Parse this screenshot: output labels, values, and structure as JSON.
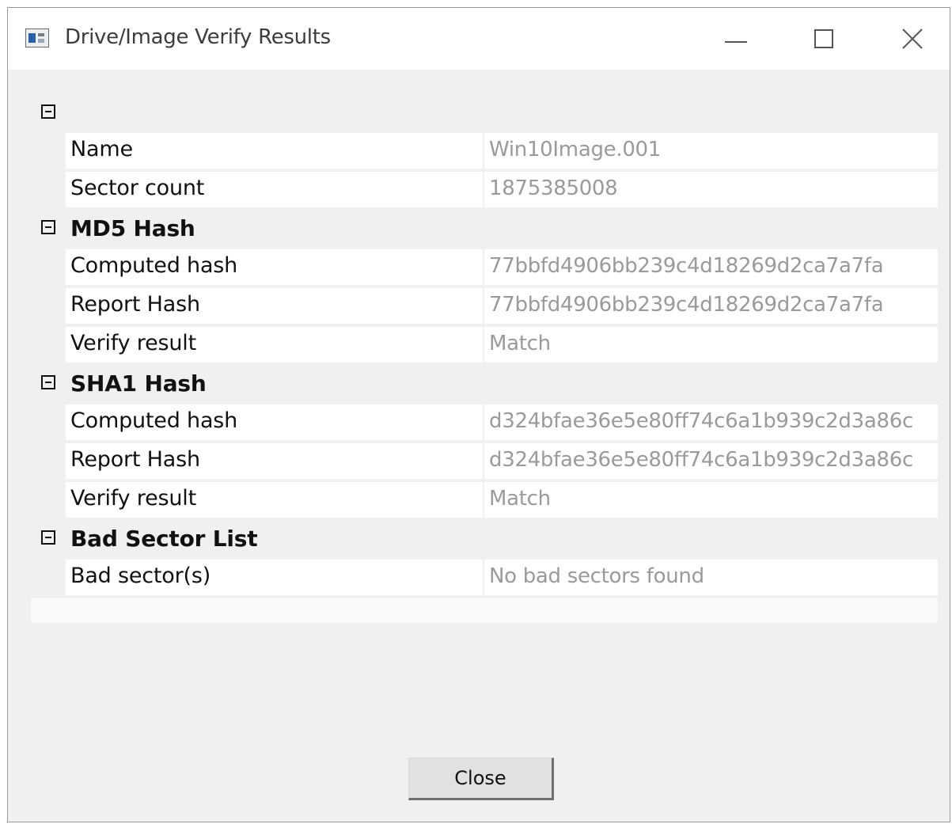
{
  "window": {
    "title": "Drive/Image Verify Results",
    "title_icon": "app-window-icon",
    "controls": {
      "minimize_icon": "minimize-icon",
      "maximize_icon": "maximize-icon",
      "close_icon": "close-icon",
      "close_glyph": "✕"
    }
  },
  "tree": {
    "root": {
      "rows": [
        {
          "name": "Name",
          "value": "Win10Image.001"
        },
        {
          "name": "Sector count",
          "value": "1875385008"
        }
      ]
    },
    "md5": {
      "title": "MD5 Hash",
      "rows": [
        {
          "name": "Computed hash",
          "value": "77bbfd4906bb239c4d18269d2ca7a7fa"
        },
        {
          "name": "Report Hash",
          "value": "77bbfd4906bb239c4d18269d2ca7a7fa"
        },
        {
          "name": "Verify result",
          "value": "Match"
        }
      ]
    },
    "sha1": {
      "title": "SHA1 Hash",
      "rows": [
        {
          "name": "Computed hash",
          "value": "d324bfae36e5e80ff74c6a1b939c2d3a86c"
        },
        {
          "name": "Report Hash",
          "value": "d324bfae36e5e80ff74c6a1b939c2d3a86c"
        },
        {
          "name": "Verify result",
          "value": "Match"
        }
      ]
    },
    "bad_sectors": {
      "title": "Bad Sector List",
      "rows": [
        {
          "name": "Bad sector(s)",
          "value": "No bad sectors found"
        }
      ]
    }
  },
  "footer": {
    "close_label": "Close"
  },
  "colors": {
    "window_bg": "#f0f0f0",
    "titlebar_bg": "#ffffff",
    "value_text": "#9a9a9a",
    "label_text": "#111111"
  }
}
